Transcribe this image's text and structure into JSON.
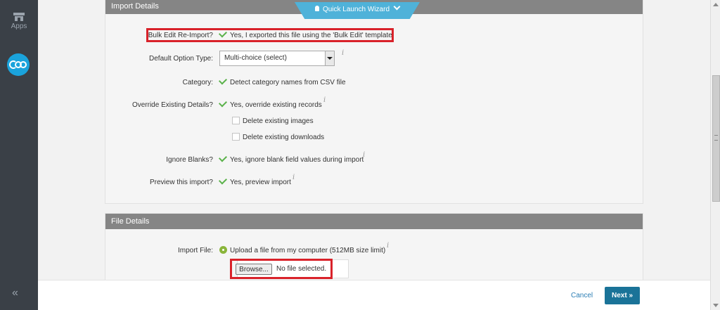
{
  "sidebar": {
    "apps_label": "Apps",
    "collapse_icon": "«"
  },
  "wizard": {
    "label": "Quick Launch Wizard"
  },
  "import_details": {
    "title": "Import Details",
    "bulk_edit": {
      "label": "Bulk Edit Re-Import?",
      "value": "Yes, I exported this file using the 'Bulk Edit' template"
    },
    "default_option_type": {
      "label": "Default Option Type:",
      "selected": "Multi-choice (select)"
    },
    "category": {
      "label": "Category:",
      "value": "Detect category names from CSV file"
    },
    "override": {
      "label": "Override Existing Details?",
      "value": "Yes, override existing records",
      "delete_images": "Delete existing images",
      "delete_downloads": "Delete existing downloads"
    },
    "ignore_blanks": {
      "label": "Ignore Blanks?",
      "value": "Yes, ignore blank field values during import"
    },
    "preview": {
      "label": "Preview this import?",
      "value": "Yes, preview import"
    },
    "info_symbol": "i"
  },
  "file_details": {
    "title": "File Details",
    "import_file": {
      "label": "Import File:",
      "value": "Upload a file from my computer (512MB size limit)"
    },
    "browse_label": "Browse...",
    "no_file": "No file selected."
  },
  "footer": {
    "cancel": "Cancel",
    "next": "Next »"
  },
  "colors": {
    "sidebar": "#3a4047",
    "accent": "#1aa3dc",
    "check": "#5bb24b",
    "highlight": "#d9222a",
    "next_button": "#1a7398",
    "section_header": "#858585"
  }
}
